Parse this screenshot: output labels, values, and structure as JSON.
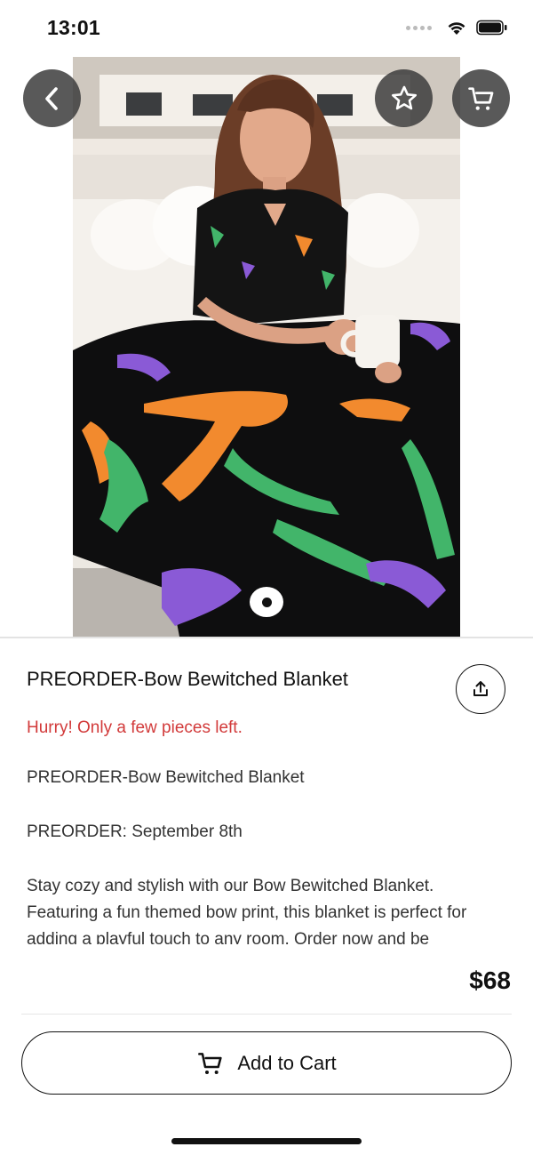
{
  "status_bar": {
    "time": "13:01"
  },
  "icons": {
    "back": "chevron-left-icon",
    "favorite": "star-icon",
    "cart": "cart-icon",
    "share": "share-icon",
    "signal": "signal-dots-icon",
    "wifi": "wifi-icon",
    "battery": "battery-icon"
  },
  "product": {
    "title": "PREORDER-Bow Bewitched Blanket",
    "stock_note": "Hurry! Only a few pieces left.",
    "description_line1": "PREORDER-Bow Bewitched Blanket",
    "description_line2": "PREORDER: September 8th",
    "description_line3": "Stay cozy and stylish with our Bow Bewitched Blanket. Featuring a fun themed bow print, this blanket is perfect for adding a playful touch to any room. Order now and be",
    "price": "$68"
  },
  "actions": {
    "add_to_cart": "Add to Cart"
  },
  "gallery": {
    "image_count": 1,
    "current_index": 1
  },
  "colors": {
    "stock_alert": "#d23a3a",
    "nav_button_bg": "#3c3c3c"
  }
}
